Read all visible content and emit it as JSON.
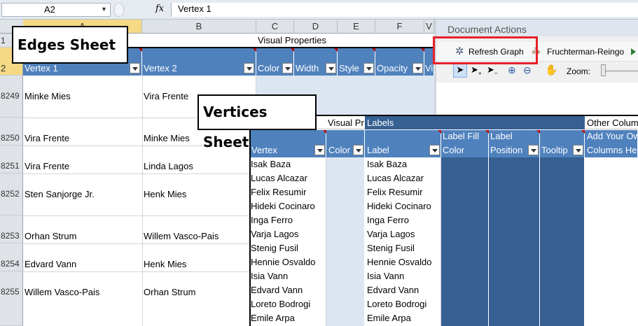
{
  "formula_bar": {
    "name_box": "A2",
    "fx": "fx",
    "value": "Vertex 1"
  },
  "columns_left": [
    "A",
    "B"
  ],
  "columns_right": [
    "C",
    "D",
    "E",
    "F",
    "V"
  ],
  "row1": {
    "number": "1",
    "group": "Visual Properties"
  },
  "row2": {
    "number": "2",
    "headers": [
      "Vertex 1",
      "Vertex 2",
      "Color",
      "Width",
      "Style",
      "Opacity",
      "Vi"
    ]
  },
  "edges_rows": [
    {
      "num": "8249",
      "v1": "Minke Mies",
      "v2": "Vira Frente"
    },
    {
      "num": "8250",
      "v1": "Vira Frente",
      "v2": "Minke Mies"
    },
    {
      "num": "8251",
      "v1": "Vira Frente",
      "v2": "Linda Lagos"
    },
    {
      "num": "8252",
      "v1": "Sten Sanjorge Jr.",
      "v2": "Henk Mies"
    },
    {
      "num": "8253",
      "v1": "Orhan Strum",
      "v2": "Willem Vasco-Pais"
    },
    {
      "num": "8254",
      "v1": "Edvard Vann",
      "v2": "Henk Mies"
    },
    {
      "num": "8255",
      "v1": "Willem Vasco-Pais",
      "v2": "Orhan Strum"
    }
  ],
  "edges_label": "Edges Sheet",
  "vertices_label": "Vertices Sheet",
  "document_actions": {
    "title": "Document Actions",
    "refresh": "Refresh Graph",
    "layout": "Fruchterman-Reingo",
    "zoom_label": "Zoom:"
  },
  "vertices_sheet": {
    "groups": {
      "visual": "Visual Pr",
      "labels": "Labels",
      "other": "Other Colum"
    },
    "headers": {
      "vertex": "Vertex",
      "color": "Color",
      "label": "Label",
      "label_fill_1": "Label Fill",
      "label_fill_2": "Color",
      "label_pos_1": "Label",
      "label_pos_2": "Position",
      "tooltip": "Tooltip",
      "add_1": "Add Your Ow",
      "add_2": "Columns He"
    },
    "vertices": [
      "Isak Baza",
      "Lucas Alcazar",
      "Felix Resumir",
      "Hideki Cocinaro",
      "Inga Ferro",
      "Varja Lagos",
      "Stenig Fusil",
      "Hennie Osvaldo",
      "Isia Vann",
      "Edvard Vann",
      "Loreto Bodrogi",
      "Emile Arpa"
    ],
    "labels": [
      "Isak Baza",
      "Lucas Alcazar",
      "Felix Resumir",
      "Hideki Cocinaro",
      "Inga Ferro",
      "Varja Lagos",
      "Stenig Fusil",
      "Hennie Osvaldo",
      "Isia Vann",
      "Edvard Vann",
      "Loreto Bodrogi",
      "Emile Arpa"
    ]
  },
  "colors": {
    "header_blue": "#4f81bd",
    "dark_blue": "#366092",
    "highlight_red": "#e8202a",
    "light_blue": "#dce6f1"
  }
}
